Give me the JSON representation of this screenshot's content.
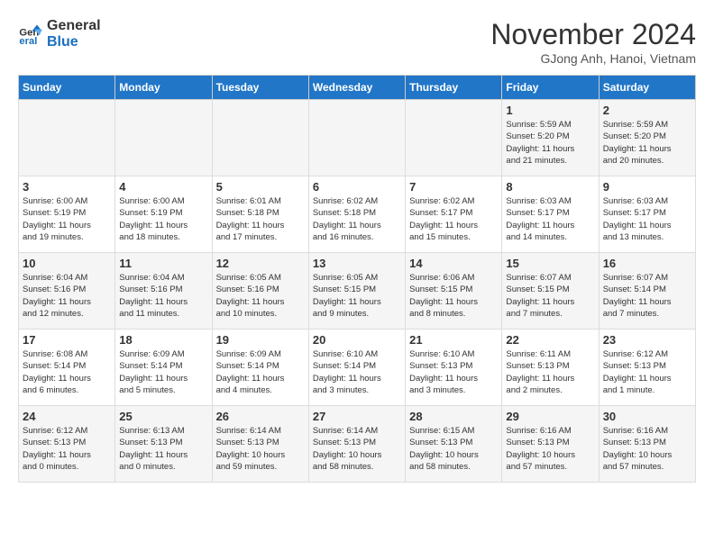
{
  "header": {
    "logo_general": "General",
    "logo_blue": "Blue",
    "month_title": "November 2024",
    "location": "GJong Anh, Hanoi, Vietnam"
  },
  "days_of_week": [
    "Sunday",
    "Monday",
    "Tuesday",
    "Wednesday",
    "Thursday",
    "Friday",
    "Saturday"
  ],
  "weeks": [
    {
      "days": [
        {
          "date": "",
          "info": ""
        },
        {
          "date": "",
          "info": ""
        },
        {
          "date": "",
          "info": ""
        },
        {
          "date": "",
          "info": ""
        },
        {
          "date": "",
          "info": ""
        },
        {
          "date": "1",
          "info": "Sunrise: 5:59 AM\nSunset: 5:20 PM\nDaylight: 11 hours\nand 21 minutes."
        },
        {
          "date": "2",
          "info": "Sunrise: 5:59 AM\nSunset: 5:20 PM\nDaylight: 11 hours\nand 20 minutes."
        }
      ]
    },
    {
      "days": [
        {
          "date": "3",
          "info": "Sunrise: 6:00 AM\nSunset: 5:19 PM\nDaylight: 11 hours\nand 19 minutes."
        },
        {
          "date": "4",
          "info": "Sunrise: 6:00 AM\nSunset: 5:19 PM\nDaylight: 11 hours\nand 18 minutes."
        },
        {
          "date": "5",
          "info": "Sunrise: 6:01 AM\nSunset: 5:18 PM\nDaylight: 11 hours\nand 17 minutes."
        },
        {
          "date": "6",
          "info": "Sunrise: 6:02 AM\nSunset: 5:18 PM\nDaylight: 11 hours\nand 16 minutes."
        },
        {
          "date": "7",
          "info": "Sunrise: 6:02 AM\nSunset: 5:17 PM\nDaylight: 11 hours\nand 15 minutes."
        },
        {
          "date": "8",
          "info": "Sunrise: 6:03 AM\nSunset: 5:17 PM\nDaylight: 11 hours\nand 14 minutes."
        },
        {
          "date": "9",
          "info": "Sunrise: 6:03 AM\nSunset: 5:17 PM\nDaylight: 11 hours\nand 13 minutes."
        }
      ]
    },
    {
      "days": [
        {
          "date": "10",
          "info": "Sunrise: 6:04 AM\nSunset: 5:16 PM\nDaylight: 11 hours\nand 12 minutes."
        },
        {
          "date": "11",
          "info": "Sunrise: 6:04 AM\nSunset: 5:16 PM\nDaylight: 11 hours\nand 11 minutes."
        },
        {
          "date": "12",
          "info": "Sunrise: 6:05 AM\nSunset: 5:16 PM\nDaylight: 11 hours\nand 10 minutes."
        },
        {
          "date": "13",
          "info": "Sunrise: 6:05 AM\nSunset: 5:15 PM\nDaylight: 11 hours\nand 9 minutes."
        },
        {
          "date": "14",
          "info": "Sunrise: 6:06 AM\nSunset: 5:15 PM\nDaylight: 11 hours\nand 8 minutes."
        },
        {
          "date": "15",
          "info": "Sunrise: 6:07 AM\nSunset: 5:15 PM\nDaylight: 11 hours\nand 7 minutes."
        },
        {
          "date": "16",
          "info": "Sunrise: 6:07 AM\nSunset: 5:14 PM\nDaylight: 11 hours\nand 7 minutes."
        }
      ]
    },
    {
      "days": [
        {
          "date": "17",
          "info": "Sunrise: 6:08 AM\nSunset: 5:14 PM\nDaylight: 11 hours\nand 6 minutes."
        },
        {
          "date": "18",
          "info": "Sunrise: 6:09 AM\nSunset: 5:14 PM\nDaylight: 11 hours\nand 5 minutes."
        },
        {
          "date": "19",
          "info": "Sunrise: 6:09 AM\nSunset: 5:14 PM\nDaylight: 11 hours\nand 4 minutes."
        },
        {
          "date": "20",
          "info": "Sunrise: 6:10 AM\nSunset: 5:14 PM\nDaylight: 11 hours\nand 3 minutes."
        },
        {
          "date": "21",
          "info": "Sunrise: 6:10 AM\nSunset: 5:13 PM\nDaylight: 11 hours\nand 3 minutes."
        },
        {
          "date": "22",
          "info": "Sunrise: 6:11 AM\nSunset: 5:13 PM\nDaylight: 11 hours\nand 2 minutes."
        },
        {
          "date": "23",
          "info": "Sunrise: 6:12 AM\nSunset: 5:13 PM\nDaylight: 11 hours\nand 1 minute."
        }
      ]
    },
    {
      "days": [
        {
          "date": "24",
          "info": "Sunrise: 6:12 AM\nSunset: 5:13 PM\nDaylight: 11 hours\nand 0 minutes."
        },
        {
          "date": "25",
          "info": "Sunrise: 6:13 AM\nSunset: 5:13 PM\nDaylight: 11 hours\nand 0 minutes."
        },
        {
          "date": "26",
          "info": "Sunrise: 6:14 AM\nSunset: 5:13 PM\nDaylight: 10 hours\nand 59 minutes."
        },
        {
          "date": "27",
          "info": "Sunrise: 6:14 AM\nSunset: 5:13 PM\nDaylight: 10 hours\nand 58 minutes."
        },
        {
          "date": "28",
          "info": "Sunrise: 6:15 AM\nSunset: 5:13 PM\nDaylight: 10 hours\nand 58 minutes."
        },
        {
          "date": "29",
          "info": "Sunrise: 6:16 AM\nSunset: 5:13 PM\nDaylight: 10 hours\nand 57 minutes."
        },
        {
          "date": "30",
          "info": "Sunrise: 6:16 AM\nSunset: 5:13 PM\nDaylight: 10 hours\nand 57 minutes."
        }
      ]
    }
  ]
}
